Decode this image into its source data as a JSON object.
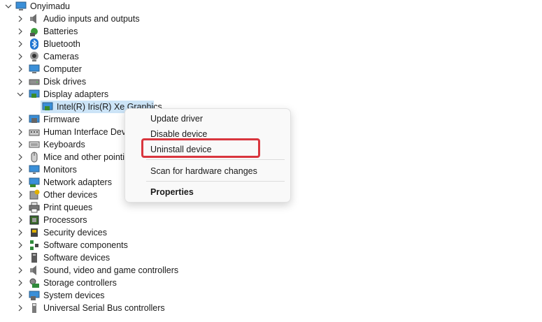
{
  "root": {
    "label": "Onyimadu",
    "expanded": true
  },
  "categories": [
    {
      "label": "Audio inputs and outputs",
      "icon": "speaker-icon"
    },
    {
      "label": "Batteries",
      "icon": "battery-icon"
    },
    {
      "label": "Bluetooth",
      "icon": "bluetooth-icon"
    },
    {
      "label": "Cameras",
      "icon": "camera-icon"
    },
    {
      "label": "Computer",
      "icon": "computer-icon"
    },
    {
      "label": "Disk drives",
      "icon": "disk-drive-icon"
    },
    {
      "label": "Display adapters",
      "icon": "display-adapter-icon",
      "expanded": true,
      "children": [
        {
          "label": "Intel(R) Iris(R) Xe Graphics",
          "icon": "display-adapter-icon",
          "selected": true
        }
      ]
    },
    {
      "label": "Firmware",
      "icon": "firmware-icon"
    },
    {
      "label": "Human Interface Devi",
      "icon": "hid-icon"
    },
    {
      "label": "Keyboards",
      "icon": "keyboard-icon"
    },
    {
      "label": "Mice and other pointi",
      "icon": "mouse-icon"
    },
    {
      "label": "Monitors",
      "icon": "monitor-icon"
    },
    {
      "label": "Network adapters",
      "icon": "network-adapter-icon"
    },
    {
      "label": "Other devices",
      "icon": "other-devices-icon"
    },
    {
      "label": "Print queues",
      "icon": "printer-icon"
    },
    {
      "label": "Processors",
      "icon": "processor-icon"
    },
    {
      "label": "Security devices",
      "icon": "security-device-icon"
    },
    {
      "label": "Software components",
      "icon": "software-component-icon"
    },
    {
      "label": "Software devices",
      "icon": "software-device-icon"
    },
    {
      "label": "Sound, video and game controllers",
      "icon": "sound-icon"
    },
    {
      "label": "Storage controllers",
      "icon": "storage-controller-icon"
    },
    {
      "label": "System devices",
      "icon": "system-device-icon"
    },
    {
      "label": "Universal Serial Bus controllers",
      "icon": "usb-icon"
    }
  ],
  "context_menu": {
    "update_driver": "Update driver",
    "disable_device": "Disable device",
    "uninstall_device": "Uninstall device",
    "scan_hardware": "Scan for hardware changes",
    "properties": "Properties",
    "highlighted_item": "Uninstall device"
  },
  "colors": {
    "selection": "#cce4f7",
    "highlight_border": "#d9363e",
    "accent": "#0078d4"
  }
}
